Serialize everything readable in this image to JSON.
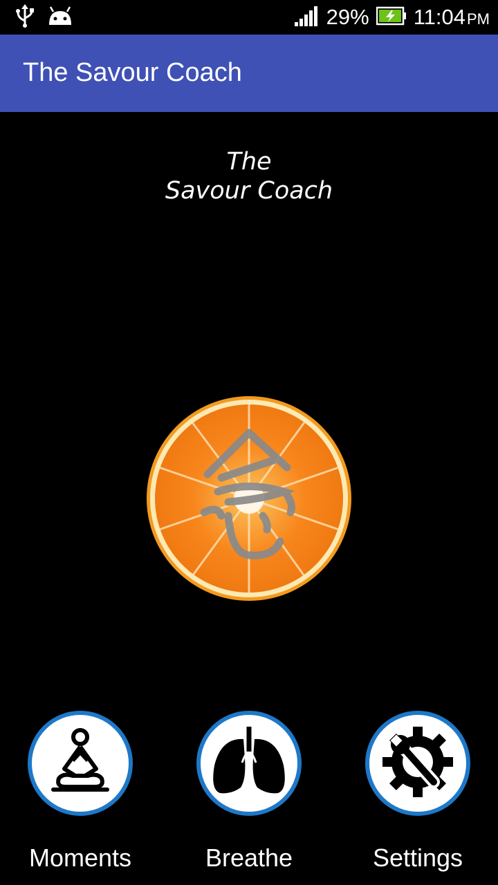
{
  "status_bar": {
    "battery": "29%",
    "time": "11:04",
    "ampm": "PM",
    "icons": [
      "usb-icon",
      "android-icon",
      "signal-icon",
      "battery-charging-icon"
    ]
  },
  "app_bar": {
    "title": "The Savour Coach"
  },
  "hero": {
    "line1": "The",
    "line2": "Savour Coach"
  },
  "logo": {
    "icon": "orange-slice-calligraphy-logo",
    "fruit_color": "#f7881f",
    "brush_color": "#8a8a8a"
  },
  "nav": {
    "accent": "#1e78c8",
    "items": [
      {
        "label": "Moments",
        "icon": "meditation-icon"
      },
      {
        "label": "Breathe",
        "icon": "lungs-icon"
      },
      {
        "label": "Settings",
        "icon": "gear-wrench-icon"
      }
    ]
  }
}
